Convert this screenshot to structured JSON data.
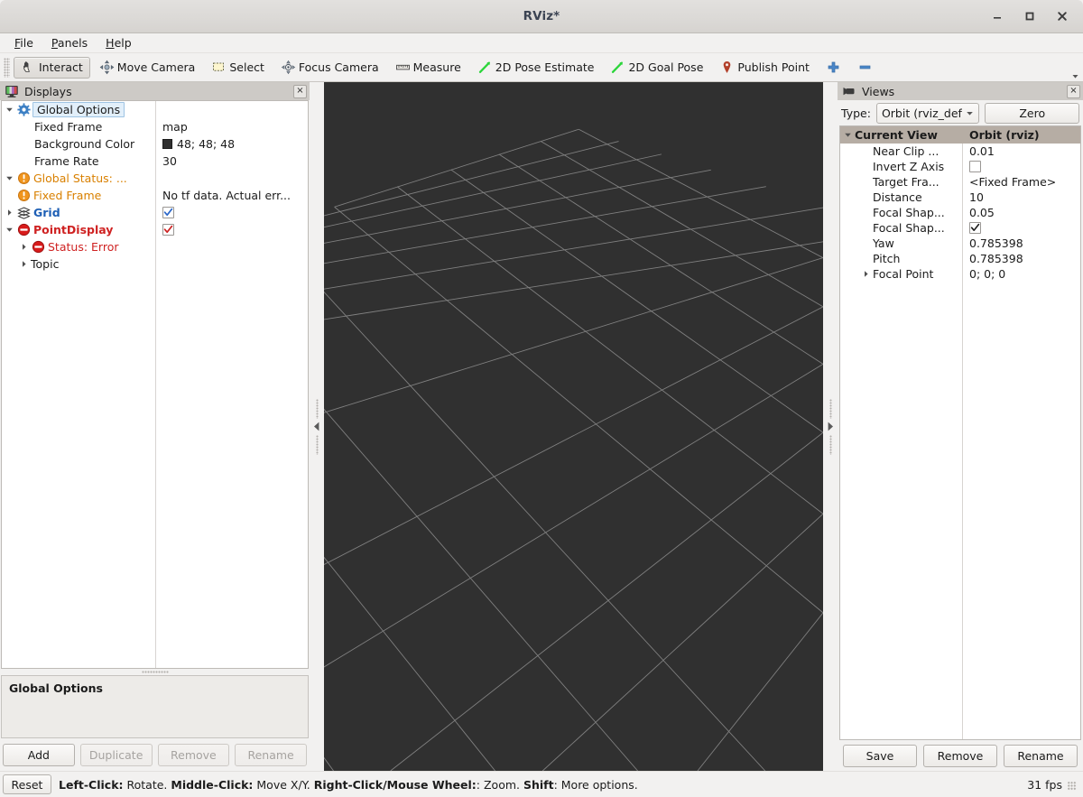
{
  "window": {
    "title": "RViz*",
    "minimize_label": "minimize",
    "maximize_label": "maximize",
    "close_label": "close"
  },
  "menu": {
    "items": [
      {
        "label": "File",
        "mnemonic": "F"
      },
      {
        "label": "Panels",
        "mnemonic": "P"
      },
      {
        "label": "Help",
        "mnemonic": "H"
      }
    ]
  },
  "toolbar": {
    "buttons": [
      {
        "label": "Interact",
        "icon": "hand-cursor-icon",
        "checked": true
      },
      {
        "label": "Move Camera",
        "icon": "move-camera-icon",
        "checked": false
      },
      {
        "label": "Select",
        "icon": "select-rect-icon",
        "checked": false
      },
      {
        "label": "Focus Camera",
        "icon": "focus-camera-icon",
        "checked": false
      },
      {
        "label": "Measure",
        "icon": "ruler-icon",
        "checked": false
      },
      {
        "label": "2D Pose Estimate",
        "icon": "pose-arrow-icon",
        "checked": false
      },
      {
        "label": "2D Goal Pose",
        "icon": "goal-arrow-icon",
        "checked": false
      },
      {
        "label": "Publish Point",
        "icon": "map-pin-icon",
        "checked": false
      }
    ],
    "extra_icons": [
      {
        "name": "plus-icon",
        "color": "#3f7fd0"
      },
      {
        "name": "minus-icon",
        "color": "#3f7fd0"
      }
    ],
    "overflow_icon": "chevron-down-icon"
  },
  "displays": {
    "panel_title": "Displays",
    "panel_icon": "displays-monitor-icon",
    "close_label": "×",
    "tree": [
      {
        "name": "Global Options",
        "value": "",
        "icon": "gear-icon",
        "expander": "down",
        "indent": 0,
        "style": "selected"
      },
      {
        "name": "Fixed Frame",
        "value": "map",
        "icon": "none",
        "expander": "none",
        "indent": 1,
        "style": "normal"
      },
      {
        "name": "Background Color",
        "value": "48; 48; 48",
        "icon": "none",
        "expander": "none",
        "indent": 1,
        "style": "normal",
        "swatch": "#303030"
      },
      {
        "name": "Frame Rate",
        "value": "30",
        "icon": "none",
        "expander": "none",
        "indent": 1,
        "style": "normal"
      },
      {
        "name": "Global Status: ...",
        "value": "",
        "icon": "warning-icon",
        "expander": "down",
        "indent": 0,
        "style": "warn"
      },
      {
        "name": "Fixed Frame",
        "value": "No tf data.  Actual err...",
        "icon": "warning-icon",
        "expander": "none",
        "indent": 1,
        "style": "warn"
      },
      {
        "name": "Grid",
        "value": "",
        "icon": "grid-layers-icon",
        "expander": "right",
        "indent": 0,
        "style": "link",
        "checkbox": "blue-check"
      },
      {
        "name": "PointDisplay",
        "value": "",
        "icon": "error-icon",
        "expander": "down",
        "indent": 0,
        "style": "error",
        "checkbox": "red-check"
      },
      {
        "name": "Status: Error",
        "value": "",
        "icon": "error-icon",
        "expander": "right",
        "indent": 1,
        "style": "error-plain"
      },
      {
        "name": "Topic",
        "value": "",
        "icon": "none",
        "expander": "right",
        "indent": 1,
        "style": "normal"
      }
    ],
    "detail_title": "Global Options",
    "buttons": [
      {
        "label": "Add",
        "enabled": true
      },
      {
        "label": "Duplicate",
        "enabled": false
      },
      {
        "label": "Remove",
        "enabled": false
      },
      {
        "label": "Rename",
        "enabled": false
      }
    ]
  },
  "views": {
    "panel_title": "Views",
    "panel_icon": "camera-icon",
    "close_label": "×",
    "type_label": "Type:",
    "type_value": "Orbit (rviz_defau",
    "zero_button": "Zero",
    "headers": {
      "name": "Current View",
      "value": "Orbit (rviz)"
    },
    "rows": [
      {
        "name": "Near Clip ...",
        "value": "0.01",
        "expander": "none",
        "indent": 1,
        "control": "text"
      },
      {
        "name": "Invert Z Axis",
        "value": "",
        "expander": "none",
        "indent": 1,
        "control": "checkbox-empty"
      },
      {
        "name": "Target Fra...",
        "value": "<Fixed Frame>",
        "expander": "none",
        "indent": 1,
        "control": "text"
      },
      {
        "name": "Distance",
        "value": "10",
        "expander": "none",
        "indent": 1,
        "control": "text"
      },
      {
        "name": "Focal Shap...",
        "value": "0.05",
        "expander": "none",
        "indent": 1,
        "control": "text"
      },
      {
        "name": "Focal Shap...",
        "value": "",
        "expander": "none",
        "indent": 1,
        "control": "checkbox-checked"
      },
      {
        "name": "Yaw",
        "value": "0.785398",
        "expander": "none",
        "indent": 1,
        "control": "text"
      },
      {
        "name": "Pitch",
        "value": "0.785398",
        "expander": "none",
        "indent": 1,
        "control": "text"
      },
      {
        "name": "Focal Point",
        "value": "0; 0; 0",
        "expander": "right",
        "indent": 1,
        "control": "text"
      }
    ],
    "buttons": [
      {
        "label": "Save",
        "enabled": true
      },
      {
        "label": "Remove",
        "enabled": true
      },
      {
        "label": "Rename",
        "enabled": true
      }
    ]
  },
  "viewport": {
    "background_color": "#303030",
    "grid_color": "#a0a0a0",
    "grid_cells": 10
  },
  "splitters": {
    "left_arrow_icon": "triangle-left-icon",
    "right_arrow_icon": "triangle-right-icon"
  },
  "statusbar": {
    "reset_label": "Reset",
    "hint_parts": [
      {
        "text": "Left-Click:",
        "bold": true
      },
      {
        "text": " Rotate. ",
        "bold": false
      },
      {
        "text": "Middle-Click:",
        "bold": true
      },
      {
        "text": " Move X/Y. ",
        "bold": false
      },
      {
        "text": "Right-Click/Mouse Wheel:",
        "bold": true
      },
      {
        "text": ": Zoom. ",
        "bold": false
      },
      {
        "text": "Shift",
        "bold": true
      },
      {
        "text": ": More options.",
        "bold": false
      }
    ],
    "fps": "31 fps"
  }
}
